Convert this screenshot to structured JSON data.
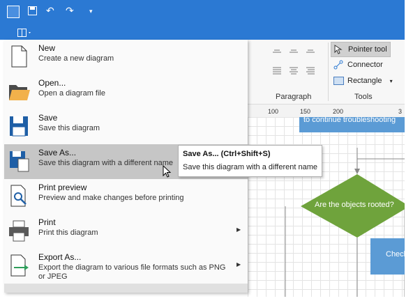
{
  "quick_access": {
    "items": [
      "new-diagram-icon",
      "save-icon",
      "undo-icon",
      "redo-icon",
      "customize-qat-icon"
    ]
  },
  "file_tab": {
    "icon": "file-menu-icon"
  },
  "ribbon": {
    "paragraph": {
      "label": "Paragraph"
    },
    "tools": {
      "label": "Tools",
      "pointer_tool": "Pointer tool",
      "connector": "Connector",
      "rectangle": "Rectangle"
    }
  },
  "ruler": {
    "ticks": [
      "100",
      "150",
      "200",
      "3"
    ]
  },
  "canvas": {
    "banner_text": "to continue troubleshooting",
    "decision_text": "Are the objects rooted?",
    "box_text": "Check",
    "colors": {
      "banner": "#5b9bd5",
      "decision": "#6fa33c",
      "box": "#5b9bd5"
    }
  },
  "menu": {
    "items": [
      {
        "title": "New",
        "desc": "Create a new diagram",
        "icon": "new-document-icon"
      },
      {
        "title": "Open...",
        "desc": "Open a diagram file",
        "icon": "folder-icon"
      },
      {
        "title": "Save",
        "desc": "Save this diagram",
        "icon": "save-icon"
      },
      {
        "title": "Save As...",
        "desc": "Save this diagram with a different name",
        "icon": "save-as-icon"
      },
      {
        "title": "Print preview",
        "desc": "Preview and make changes before printing",
        "icon": "print-preview-icon"
      },
      {
        "title": "Print",
        "desc": "Print this diagram",
        "icon": "printer-icon"
      },
      {
        "title": "Export As...",
        "desc": "Export the diagram to various file formats such as PNG or JPEG",
        "icon": "export-icon"
      }
    ]
  },
  "tooltip": {
    "title": "Save As... (Ctrl+Shift+S)",
    "desc": "Save this diagram with a different name"
  },
  "colors": {
    "accent": "#2b79d3",
    "menu_hover": "#c6c6c6"
  }
}
